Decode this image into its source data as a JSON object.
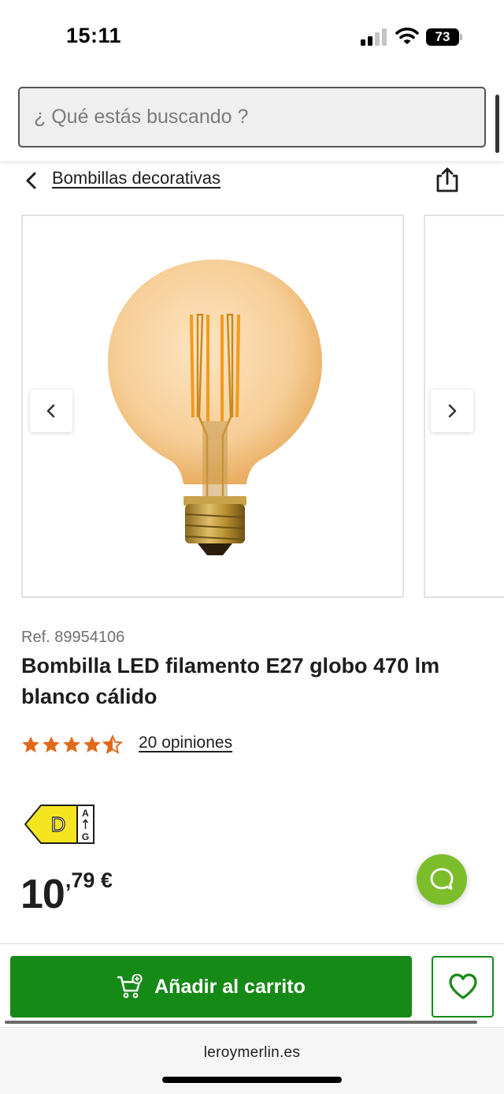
{
  "status": {
    "time": "15:11",
    "battery": "73"
  },
  "search": {
    "placeholder": "¿ Qué estás buscando ?"
  },
  "breadcrumb": {
    "label": "Bombillas decorativas"
  },
  "product": {
    "ref": "Ref. 89954106",
    "title": "Bombilla LED filamento E27 globo 470 lm blanco cálido",
    "rating": 4.5,
    "rating_max": 5,
    "reviews": "20 opiniones",
    "energy_class": "D",
    "energy_scale_top": "A",
    "energy_scale_bottom": "G",
    "price_int": "10",
    "price_dec": ",79 €"
  },
  "actions": {
    "add_to_cart": "Añadir al carrito"
  },
  "browser": {
    "url": "leroymerlin.es"
  },
  "colors": {
    "brand_green": "#168a17",
    "chat_green": "#7cbd2b",
    "star_orange": "#e06a1b",
    "energy_yellow": "#f5e521"
  },
  "icons": {
    "back": "chevron-left-icon",
    "share": "share-icon",
    "prev": "chevron-left-icon",
    "next": "chevron-right-icon",
    "cart": "cart-add-icon",
    "wishlist": "heart-icon",
    "chat": "chat-bubble-icon"
  }
}
